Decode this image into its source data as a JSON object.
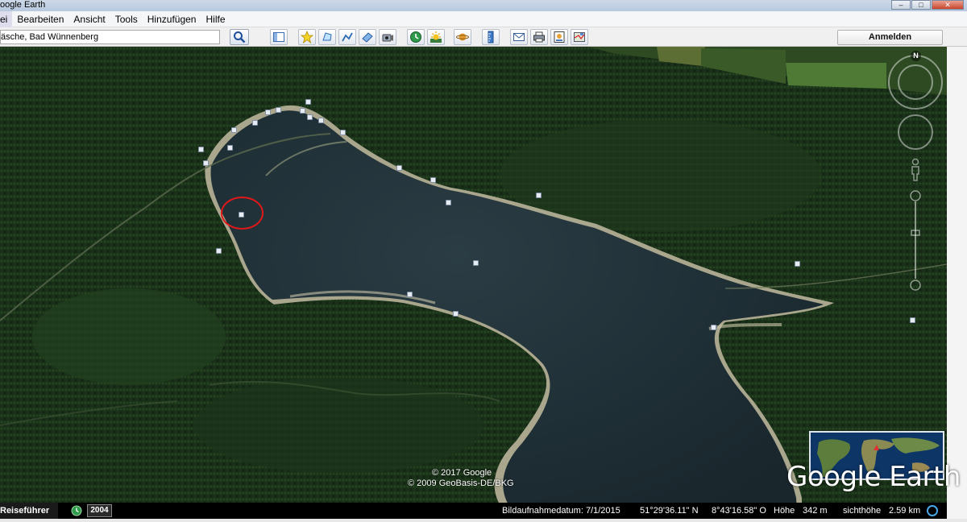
{
  "window": {
    "title": "oogle Earth"
  },
  "menu": [
    "ei",
    "Bearbeiten",
    "Ansicht",
    "Tools",
    "Hinzufügen",
    "Hilfe"
  ],
  "search": {
    "value": "äsche, Bad Wünnenberg"
  },
  "toolbar": {
    "login_label": "Anmelden"
  },
  "map": {
    "compass_north": "N",
    "copyright": [
      "© 2017 Google",
      "© 2009 GeoBasis-DE/BKG"
    ],
    "logo_text": "Google Earth",
    "highlight_color": "#e01818"
  },
  "statusbar": {
    "tour_label": "Reiseführer",
    "year": "2004",
    "imagery_date": "Bildaufnahmedatum: 7/1/2015",
    "latitude": "51°29'36.11\" N",
    "longitude": "8°43'16.58\" O",
    "elevation_label": "Höhe",
    "elevation": "342 m",
    "eye_alt_label": "sichthöhe",
    "eye_alt": "2.59 km"
  }
}
